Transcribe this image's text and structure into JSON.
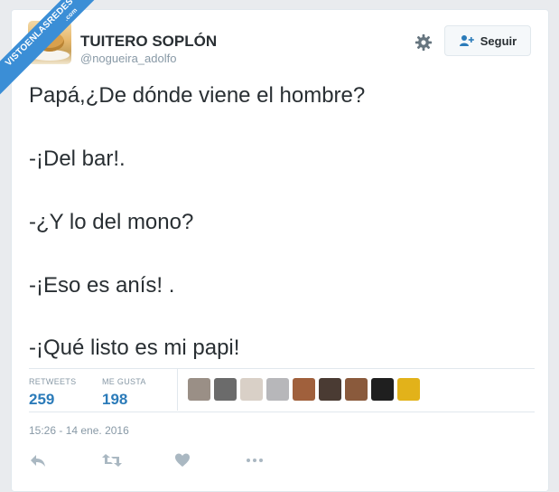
{
  "watermark": {
    "line1": "VISTOENLASREDES",
    "line2": ".com",
    "color": "#3b8ed6"
  },
  "user": {
    "display_name": "TUITERO SOPLÓN",
    "handle": "@nogueira_adolfo"
  },
  "header": {
    "follow_label": "Seguir",
    "settings_icon": "gear-icon",
    "follow_icon": "add-user-icon"
  },
  "tweet": {
    "lines": [
      "Papá,¿De dónde viene el hombre?",
      "-¡Del bar!.",
      "-¿Y lo del mono?",
      "-¡Eso es anís! .",
      "-¡Qué listo es mi papi!"
    ]
  },
  "stats": {
    "retweets_label": "RETWEETS",
    "retweets_value": "259",
    "likes_label": "ME GUSTA",
    "likes_value": "198"
  },
  "likers": [
    {
      "color": "#9a8f86"
    },
    {
      "color": "#6b6b6b"
    },
    {
      "color": "#d9d0c7"
    },
    {
      "color": "#b7b7ba"
    },
    {
      "color": "#a0603c"
    },
    {
      "color": "#4a3b33"
    },
    {
      "color": "#8a5a3c"
    },
    {
      "color": "#1f1f1f"
    },
    {
      "color": "#e2b21a"
    }
  ],
  "timestamp": "15:26 - 14 ene. 2016",
  "actions": [
    "reply-icon",
    "retweet-icon",
    "like-icon",
    "more-icon"
  ],
  "colors": {
    "link": "#2b7bb9",
    "muted": "#8899a6",
    "text": "#292f33",
    "icon": "#aab8c2"
  }
}
